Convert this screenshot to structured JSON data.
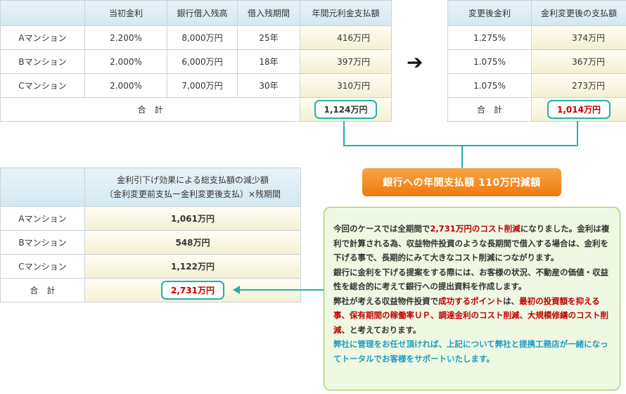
{
  "table1": {
    "headers": [
      "",
      "当初金利",
      "銀行借入残高",
      "借入残期間",
      "年間元利金支払額"
    ],
    "rows": [
      {
        "name": "Aマンション",
        "rate": "2.200%",
        "balance": "8,000万円",
        "period": "25年",
        "payment": "416万円"
      },
      {
        "name": "Bマンション",
        "rate": "2.000%",
        "balance": "6,000万円",
        "period": "18年",
        "payment": "397万円"
      },
      {
        "name": "Cマンション",
        "rate": "2.000%",
        "balance": "7,000万円",
        "period": "30年",
        "payment": "310万円"
      }
    ],
    "total_label": "合　計",
    "total": "1,124万円"
  },
  "arrow": "➔",
  "table2": {
    "headers": [
      "変更後金利",
      "金利変更後の支払額"
    ],
    "rows": [
      {
        "rate": "1.275%",
        "payment": "374万円"
      },
      {
        "rate": "1.075%",
        "payment": "367万円"
      },
      {
        "rate": "1.075%",
        "payment": "273万円"
      }
    ],
    "total_label": "合　計",
    "total": "1,014万円"
  },
  "banner": "銀行への年間支払額 110万円減額",
  "table3": {
    "header_line1": "金利引下げ効果による総支払額の減少額",
    "header_line2": "（金利変更前支払ー金利変更後支払）×残期間",
    "rows": [
      {
        "name": "Aマンション",
        "value": "1,061万円"
      },
      {
        "name": "Bマンション",
        "value": "548万円"
      },
      {
        "name": "Cマンション",
        "value": "1,122万円"
      }
    ],
    "total_label": "合　計",
    "total": "2,731万円"
  },
  "note": {
    "p1_a": "今回のケースでは全期間で",
    "p1_red": "2,731万円のコスト削減",
    "p1_b": "になりました。金利は複利で計算される為、収益物件投資のような長期間で借入する場合は、金利を下げる事で、長期的にみて大きなコスト削減につながります。",
    "p2": "銀行に金利を下げる提案をする際には、お客様の状況、不動産の価値・収益性を総合的に考えて銀行への提出資料を作成します。",
    "p3_a": "弊社が考える収益物件投資で",
    "p3_red1": "成功するポイント",
    "p3_b": "は、",
    "p3_red2": "最初の投資額を抑える事、保有期間の稼働率ＵＰ、調達金利のコスト削減、大規模修繕のコスト削減",
    "p3_c": "、と考えております。",
    "p4": "弊社に管理をお任せ頂ければ、上記について弊社と提携工務店が一緒になってトータルでお客様をサポートいたします。"
  }
}
